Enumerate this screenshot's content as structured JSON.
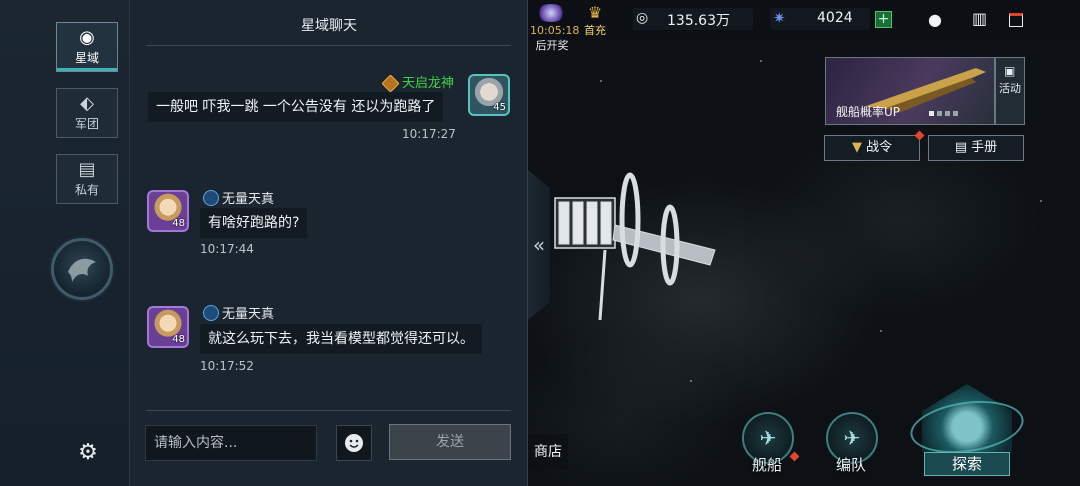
{
  "nav": {
    "tabs": [
      {
        "label": "星域",
        "icon": "globe-icon",
        "active": true
      },
      {
        "label": "军团",
        "icon": "legion-icon",
        "active": false
      },
      {
        "label": "私有",
        "icon": "private-chat-icon",
        "active": false
      }
    ],
    "avatar_icon": "phoenix-emblem-icon",
    "settings_icon": "gear-icon"
  },
  "chat": {
    "title": "星域聊天",
    "messages": [
      {
        "side": "right",
        "name": "天启龙神",
        "name_color": "#3fd24a",
        "text": "一般吧 吓我一跳 一个公告没有 还以为跑路了",
        "time": "10:17:27",
        "level": "45"
      },
      {
        "side": "left",
        "name": "无量天真",
        "name_color": "#e8ecef",
        "text": "有啥好跑路的?",
        "time": "10:17:44",
        "level": "48"
      },
      {
        "side": "left",
        "name": "无量天真",
        "name_color": "#e8ecef",
        "text": "就这么玩下去，我当看模型都觉得还可以。",
        "time": "10:17:52",
        "level": "48"
      }
    ],
    "input_placeholder": "请输入内容...",
    "send_label": "发送",
    "emoji_icon": "emoji-face-icon",
    "collapse_icon": "double-chevron-left-icon"
  },
  "topbar": {
    "timer": "10:05:18",
    "timer_caption": "后开奖",
    "first_charge": "首充",
    "credits": "135.63万",
    "crystals": "4024",
    "icons": [
      "profile-icon",
      "ranking-icon",
      "battery-icon"
    ]
  },
  "event": {
    "label": "舰船概率UP",
    "side_label": "活动",
    "pages": 4,
    "active_page": 1
  },
  "buttons": {
    "battle_order": "战令",
    "handbook": "手册"
  },
  "bottom": {
    "shop": "商店",
    "ships": "舰船",
    "fleet": "编队",
    "explore": "探索"
  },
  "colors": {
    "accent_teal": "#3fb3b0",
    "notify_red": "#e0452e",
    "guild_green": "#3fd24a"
  }
}
